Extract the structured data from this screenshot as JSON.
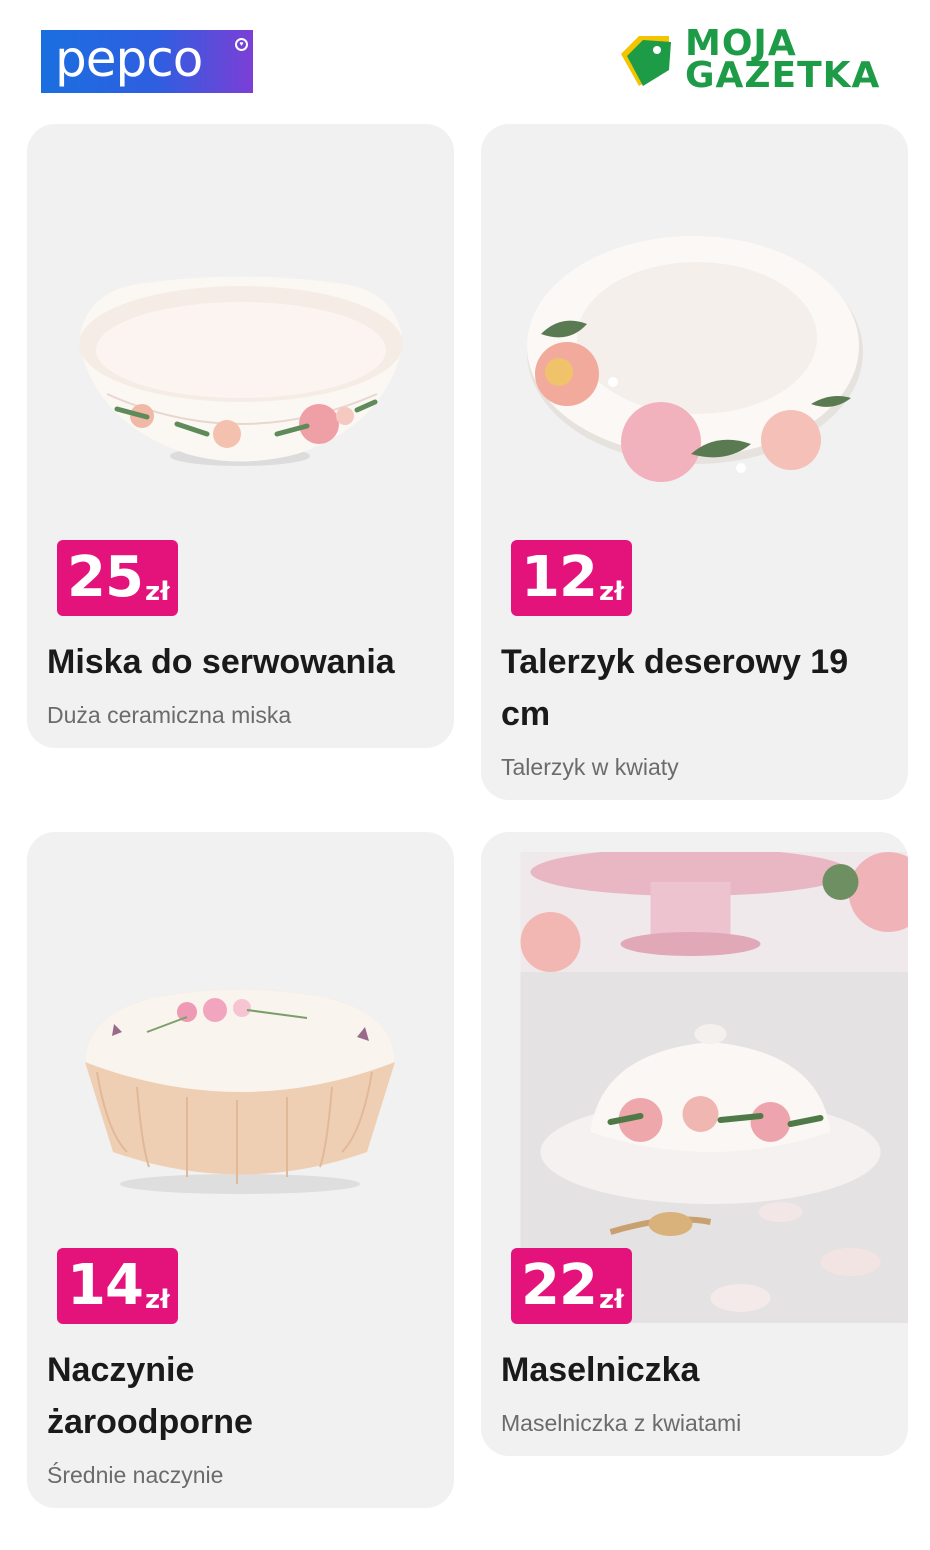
{
  "header": {
    "pepco_logo_text": "pepco",
    "moja_logo_line1": "MOJA",
    "moja_logo_line2": "GAZETKA",
    "colors": {
      "pepco_blue": "#1a6fe0",
      "moja_green": "#1e9b46"
    }
  },
  "products": [
    {
      "price": "25",
      "currency": "zł",
      "title": "Miska do serwowania",
      "subtitle": "Duża ceramiczna miska",
      "image": "floral-serving-bowl"
    },
    {
      "price": "12",
      "currency": "zł",
      "title": "Talerzyk deserowy 19 cm",
      "subtitle": "Talerzyk w kwiaty",
      "image": "floral-dessert-plate"
    },
    {
      "price": "14",
      "currency": "zł",
      "title": "Naczynie żaroodporne",
      "subtitle": "Średnie naczynie",
      "image": "scalloped-baking-dish"
    },
    {
      "price": "22",
      "currency": "zł",
      "title": "Maselniczka",
      "subtitle": "Maselniczka z kwiatami",
      "image": "floral-butter-dish-photo"
    }
  ],
  "colors": {
    "price_badge": "#e4137c",
    "card_bg": "#f1f1f1"
  }
}
